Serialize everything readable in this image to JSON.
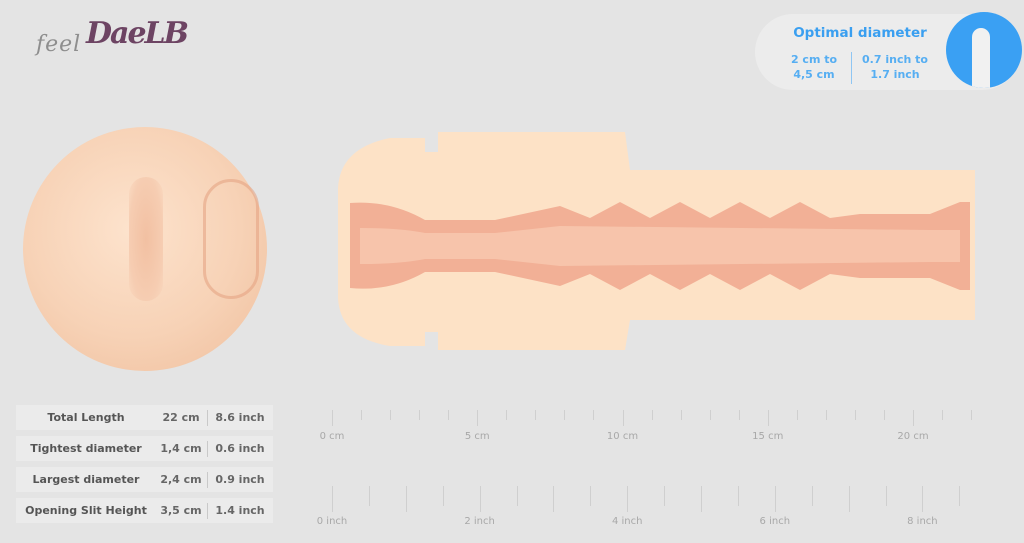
{
  "logo": {
    "prefix": "feel",
    "name": "DaeLB"
  },
  "optimal_diameter": {
    "title": "Optimal diameter",
    "cm_line1": "2 cm to",
    "cm_line2": "4,5 cm",
    "inch_line1": "0.7 inch to",
    "inch_line2": "1.7 inch",
    "accent_color": "#3aa0f3",
    "icon": "body-icon"
  },
  "specs": [
    {
      "label": "Total Length",
      "cm": "22 cm",
      "inch": "8.6 inch"
    },
    {
      "label": "Tightest diameter",
      "cm": "1,4 cm",
      "inch": "0.6 inch"
    },
    {
      "label": "Largest diameter",
      "cm": "2,4 cm",
      "inch": "0.9 inch"
    },
    {
      "label": "Opening Slit Height",
      "cm": "3,5 cm",
      "inch": "1.4 inch"
    }
  ],
  "ruler_cm": {
    "max": 22,
    "labels": [
      {
        "value": 0,
        "text": "0 cm"
      },
      {
        "value": 5,
        "text": "5 cm"
      },
      {
        "value": 10,
        "text": "10 cm"
      },
      {
        "value": 15,
        "text": "15 cm"
      },
      {
        "value": 20,
        "text": "20 cm"
      }
    ]
  },
  "ruler_inch": {
    "max": 8.5,
    "step": 0.5,
    "labels": [
      {
        "value": 0,
        "text": "0 inch"
      },
      {
        "value": 2,
        "text": "2 inch"
      },
      {
        "value": 4,
        "text": "4 inch"
      },
      {
        "value": 6,
        "text": "6 inch"
      },
      {
        "value": 8,
        "text": "8 inch"
      }
    ]
  },
  "colors": {
    "product_base": "#fde2c6",
    "product_inner": "#f2a98c",
    "label_blue": "#3a9ff0"
  }
}
